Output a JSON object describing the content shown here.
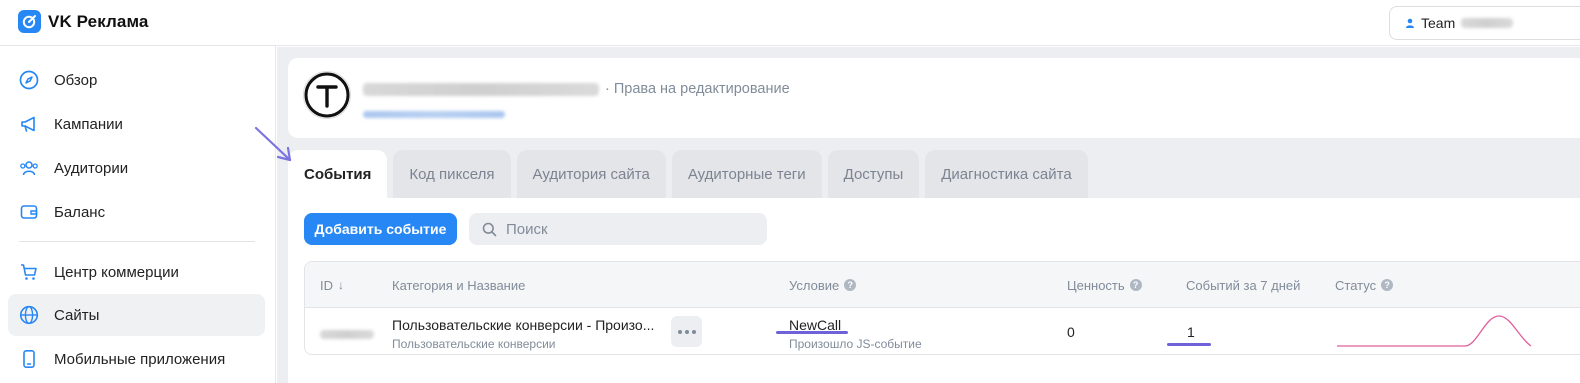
{
  "app": {
    "title": "VK Реклама"
  },
  "header": {
    "account_label": "Team"
  },
  "sidebar": {
    "items": [
      {
        "label": "Обзор",
        "icon": "compass-icon"
      },
      {
        "label": "Кампании",
        "icon": "megaphone-icon"
      },
      {
        "label": "Аудитории",
        "icon": "audience-icon"
      },
      {
        "label": "Баланс",
        "icon": "wallet-icon"
      },
      {
        "label": "Центр коммерции",
        "icon": "cart-icon"
      },
      {
        "label": "Сайты",
        "icon": "globe-icon",
        "active": true
      },
      {
        "label": "Мобильные приложения",
        "icon": "phone-icon"
      }
    ]
  },
  "site": {
    "rights_label": "· Права на редактирование"
  },
  "tabs": [
    {
      "label": "События",
      "active": true
    },
    {
      "label": "Код пикселя"
    },
    {
      "label": "Аудитория сайта"
    },
    {
      "label": "Аудиторные теги"
    },
    {
      "label": "Доступы"
    },
    {
      "label": "Диагностика сайта"
    }
  ],
  "toolbar": {
    "add_label": "Добавить событие",
    "search_placeholder": "Поиск"
  },
  "table": {
    "columns": {
      "id": "ID",
      "name": "Категория и Название",
      "condition": "Условие",
      "value": "Ценность",
      "events7d": "Событий за 7 дней",
      "status": "Статус"
    },
    "rows": [
      {
        "name": "Пользовательские конверсии - Произо...",
        "category": "Пользовательские конверсии",
        "condition": "NewCall",
        "condition_sub": "Произошло JS-событие",
        "value": "0",
        "events7d": "1"
      }
    ]
  },
  "colors": {
    "accent": "#2787f5",
    "annotation": "#6f62d8",
    "sparkline": "#e0609c"
  }
}
